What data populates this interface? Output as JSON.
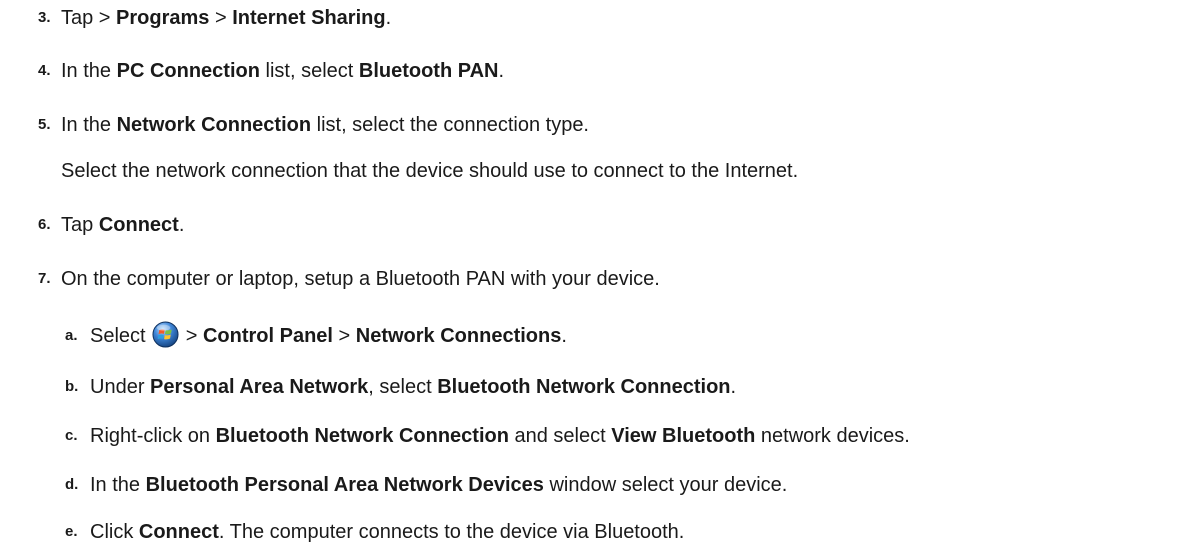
{
  "steps": [
    {
      "num": "3.",
      "parts": [
        "Tap > ",
        "Programs",
        " > ",
        "Internet Sharing",
        "."
      ]
    },
    {
      "num": "4.",
      "parts": [
        "In the ",
        "PC Connection",
        " list, select ",
        "Bluetooth PAN",
        "."
      ]
    },
    {
      "num": "5.",
      "parts": [
        "In the ",
        "Network Connection",
        " list, select the connection type."
      ],
      "note": "Select the network connection that the device should use to connect to the Internet."
    },
    {
      "num": "6.",
      "parts": [
        "Tap ",
        "Connect",
        "."
      ]
    },
    {
      "num": "7.",
      "parts": [
        "On the computer or laptop, setup a Bluetooth PAN with your device."
      ]
    }
  ],
  "substeps": [
    {
      "num": "a.",
      "parts": [
        "Select ",
        " > ",
        "Control Panel",
        " > ",
        "Network Connections",
        "."
      ],
      "icon": "windows-start-orb-icon"
    },
    {
      "num": "b.",
      "parts": [
        "Under ",
        "Personal Area Network",
        ", select ",
        "Bluetooth Network Connection",
        "."
      ]
    },
    {
      "num": "c.",
      "parts": [
        "Right-click on ",
        "Bluetooth Network Connection",
        " and select ",
        "View Bluetooth",
        " network devices."
      ]
    },
    {
      "num": "d.",
      "parts": [
        "In the ",
        "Bluetooth Personal Area Network Devices",
        " window select your device."
      ]
    },
    {
      "num": "e.",
      "parts": [
        "Click ",
        "Connect",
        ". The computer connects to the device via Bluetooth."
      ]
    }
  ],
  "colors": {
    "text": "#1a1a1a",
    "orb_blue": "#2a6fc4"
  }
}
